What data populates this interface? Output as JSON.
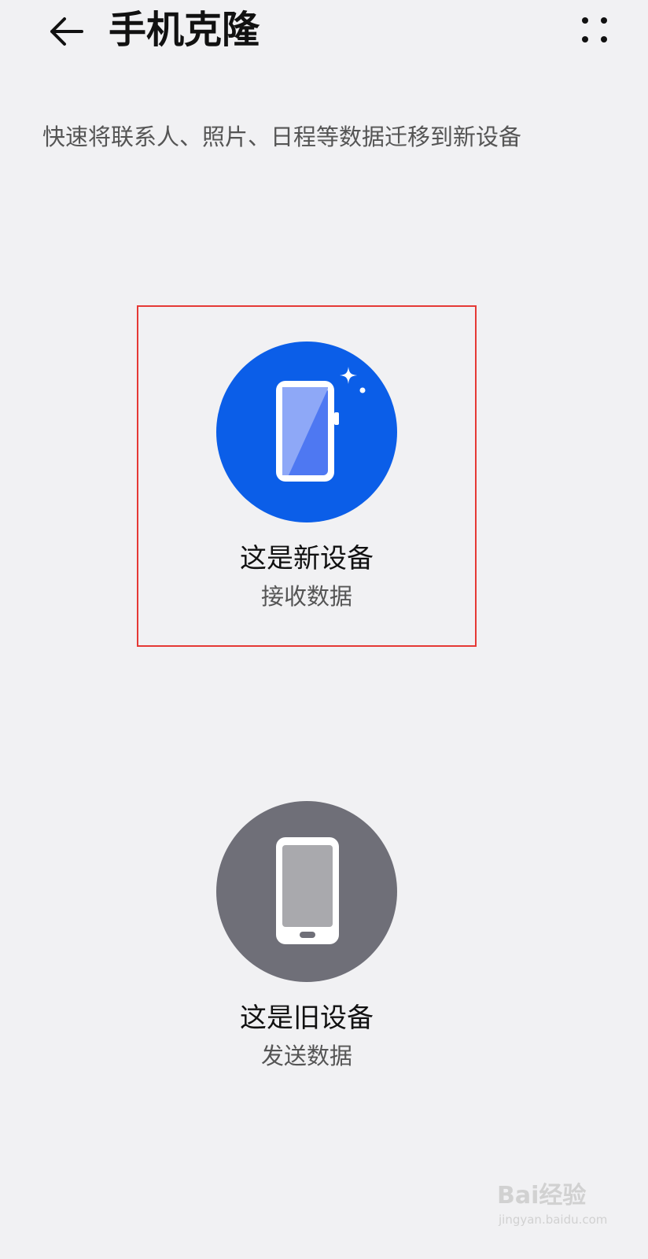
{
  "header": {
    "title": "手机克隆",
    "back_icon": "back-arrow-icon",
    "more_icon": "more-dots-icon"
  },
  "description": "快速将联系人、照片、日程等数据迁移到新设备",
  "options": {
    "new_device": {
      "label": "这是新设备",
      "sub": "接收数据",
      "icon": "new-phone-icon",
      "accent": "#0b5ee8",
      "highlight_border": "#e53935"
    },
    "old_device": {
      "label": "这是旧设备",
      "sub": "发送数据",
      "icon": "old-phone-icon",
      "accent": "#6f6f78"
    }
  },
  "watermark": {
    "brand": "Bai经验",
    "url": "jingyan.baidu.com"
  }
}
